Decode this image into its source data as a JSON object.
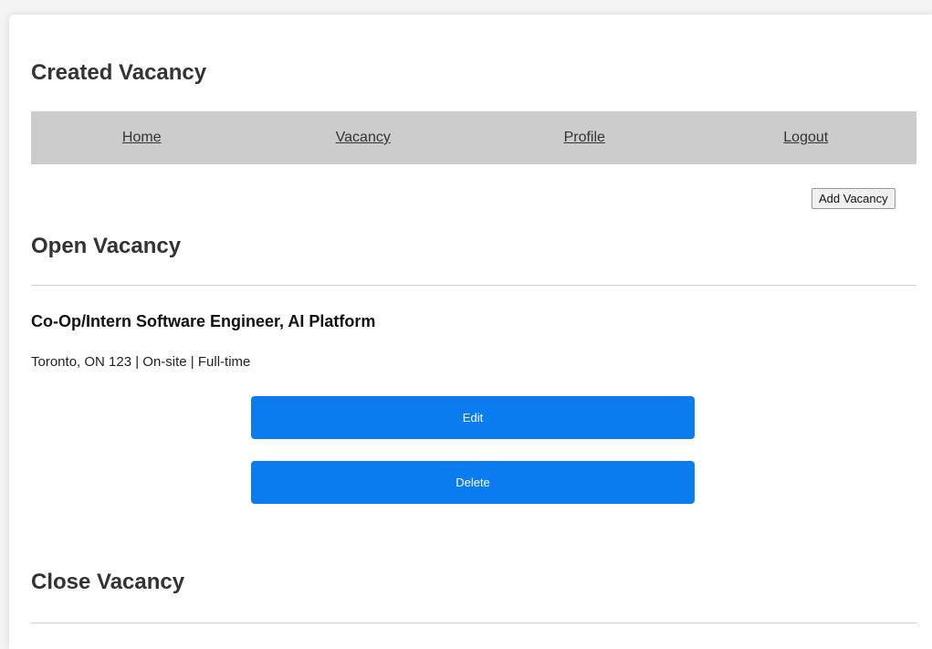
{
  "page": {
    "title": "Created Vacancy"
  },
  "nav": {
    "items": [
      "Home",
      "Vacancy",
      "Profile",
      "Logout"
    ]
  },
  "toolbar": {
    "add_label": "Add Vacancy"
  },
  "open_section": {
    "title": "Open Vacancy",
    "vacancies": [
      {
        "title": "Co-Op/Intern Software Engineer, AI Platform",
        "meta": "Toronto, ON 123 | On-site | Full-time",
        "edit_label": "Edit",
        "delete_label": "Delete"
      }
    ]
  },
  "close_section": {
    "title": "Close Vacancy"
  },
  "colors": {
    "accent": "#0a7cf0",
    "nav_bg": "#cccccc"
  }
}
